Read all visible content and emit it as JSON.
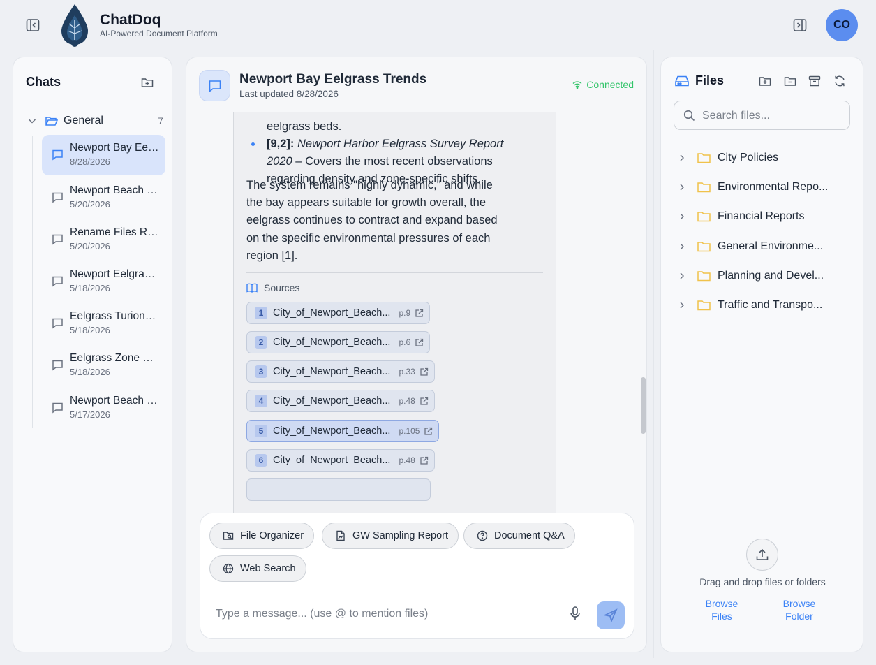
{
  "app": {
    "name": "ChatDoq",
    "tagline": "AI-Powered Document Platform",
    "user_initials": "CO"
  },
  "sidebar": {
    "title": "Chats",
    "folder": {
      "name": "General",
      "count": "7"
    },
    "chats": [
      {
        "title": "Newport Bay Eelgrass Trends",
        "date": "8/28/2026",
        "active": true
      },
      {
        "title": "Newport Beach Eelgrass",
        "date": "5/20/2026"
      },
      {
        "title": "Rename Files Request",
        "date": "5/20/2026"
      },
      {
        "title": "Newport Eelgrass Survey",
        "date": "5/18/2026"
      },
      {
        "title": "Eelgrass Turions Count",
        "date": "5/18/2026"
      },
      {
        "title": "Eelgrass Zone Mapping",
        "date": "5/18/2026"
      },
      {
        "title": "Newport Beach Harbor",
        "date": "5/17/2026"
      }
    ]
  },
  "conversation": {
    "title": "Newport Bay Eelgrass Trends",
    "updated": "Last updated 8/28/2026",
    "status": "Connected"
  },
  "message": {
    "bullet_prev_tail": "eelgrass beds.",
    "bullet_ref": "[9,2]:",
    "bullet_italic": "Newport Harbor Eelgrass Survey Report 2020",
    "bullet_rest": " – Covers the most recent observations regarding density and zone-specific shifts.",
    "paragraph": "The system remains \"highly dynamic,\" and while the bay appears suitable for growth overall, the eelgrass continues to contract and expand based on the specific environmental pressures of each region [1].",
    "sources_label": "Sources",
    "sources": [
      {
        "num": "1",
        "name": "City_of_Newport_Beach...",
        "page": "p.9"
      },
      {
        "num": "2",
        "name": "City_of_Newport_Beach...",
        "page": "p.6"
      },
      {
        "num": "3",
        "name": "City_of_Newport_Beach...",
        "page": "p.33"
      },
      {
        "num": "4",
        "name": "City_of_Newport_Beach...",
        "page": "p.48"
      },
      {
        "num": "5",
        "name": "City_of_Newport_Beach...",
        "page": "p.105",
        "selected": true
      },
      {
        "num": "6",
        "name": "City_of_Newport_Beach...",
        "page": "p.48"
      }
    ]
  },
  "composer": {
    "quick_actions": [
      "File Organizer",
      "GW Sampling Report",
      "Document Q&A",
      "Web Search"
    ],
    "placeholder": "Type a message... (use @ to mention files)"
  },
  "files": {
    "title": "Files",
    "search_placeholder": "Search files...",
    "folders": [
      "City Policies",
      "Environmental Repo...",
      "Financial Reports",
      "General Environme...",
      "Planning and Devel...",
      "Traffic and Transpo..."
    ],
    "drop_text": "Drag and drop files or folders",
    "browse_files": "Browse Files",
    "browse_folder": "Browse Folder"
  },
  "colors": {
    "accent": "#3b82f6",
    "connected": "#34c56b",
    "folder": "#f0c24b",
    "active_chat": "#d9e4fb"
  }
}
